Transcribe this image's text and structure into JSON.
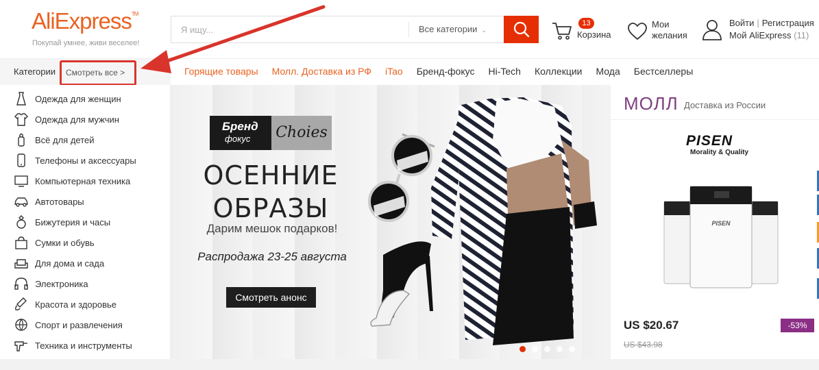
{
  "header": {
    "logo": "AliExpress",
    "tagline": "Покупай умнее, живи веселее!",
    "search": {
      "placeholder": "Я ищу...",
      "category": "Все категории"
    },
    "cart": {
      "count": "13",
      "label": "Корзина"
    },
    "wishlist": {
      "line1": "Мои",
      "line2": "желания"
    },
    "account": {
      "login": "Войти",
      "register": "Регистрация",
      "my": "Мой AliExpress",
      "count": "(11)"
    }
  },
  "nav": {
    "categories_label": "Категории",
    "see_all": "Смотреть все >",
    "links": [
      {
        "label": "Горящие товары",
        "highlight": true
      },
      {
        "label": "Молл. Доставка из РФ",
        "highlight": true
      },
      {
        "label": "iTao",
        "highlight": true
      },
      {
        "label": "Бренд-фокус",
        "highlight": false
      },
      {
        "label": "Hi-Tech",
        "highlight": false
      },
      {
        "label": "Коллекции",
        "highlight": false
      },
      {
        "label": "Мода",
        "highlight": false
      },
      {
        "label": "Бестселлеры",
        "highlight": false
      }
    ]
  },
  "sidebar": {
    "items": [
      {
        "label": "Одежда для женщин",
        "icon": "dress-icon"
      },
      {
        "label": "Одежда для мужчин",
        "icon": "tshirt-icon"
      },
      {
        "label": "Всё для детей",
        "icon": "baby-bottle-icon"
      },
      {
        "label": "Телефоны и аксессуары",
        "icon": "phone-icon"
      },
      {
        "label": "Компьютерная техника",
        "icon": "monitor-icon"
      },
      {
        "label": "Автотовары",
        "icon": "car-icon"
      },
      {
        "label": "Бижутерия и часы",
        "icon": "ring-icon"
      },
      {
        "label": "Сумки и обувь",
        "icon": "bag-icon"
      },
      {
        "label": "Для дома и сада",
        "icon": "sofa-icon"
      },
      {
        "label": "Электроника",
        "icon": "headphones-icon"
      },
      {
        "label": "Красота и здоровье",
        "icon": "brush-icon"
      },
      {
        "label": "Спорт и развлечения",
        "icon": "ball-icon"
      },
      {
        "label": "Техника и инструменты",
        "icon": "drill-icon"
      }
    ]
  },
  "banner": {
    "brand_left_1": "Бренд",
    "brand_left_2": "фокус",
    "brand_right": "Choies",
    "title_1": "ОСЕННИЕ",
    "title_2": "ОБРАЗЫ",
    "subtitle": "Дарим мешок подарков!",
    "sale": "Распродажа 23-25 августа",
    "button": "Смотреть анонс",
    "slides": 5,
    "active_slide": 1
  },
  "mall": {
    "title": "МОЛЛ",
    "subtitle": "Доставка из России",
    "brand": "PISEN",
    "brand_tag": "Morality & Quality",
    "price": "US $20.67",
    "old_price": "US $43.98",
    "discount": "-53%"
  },
  "colors": {
    "brand_orange": "#e96322",
    "search_red": "#e62e04",
    "mall_purple": "#7f3f7f",
    "discount_purple": "#8b2e86",
    "annotation_red": "#d9342b"
  }
}
